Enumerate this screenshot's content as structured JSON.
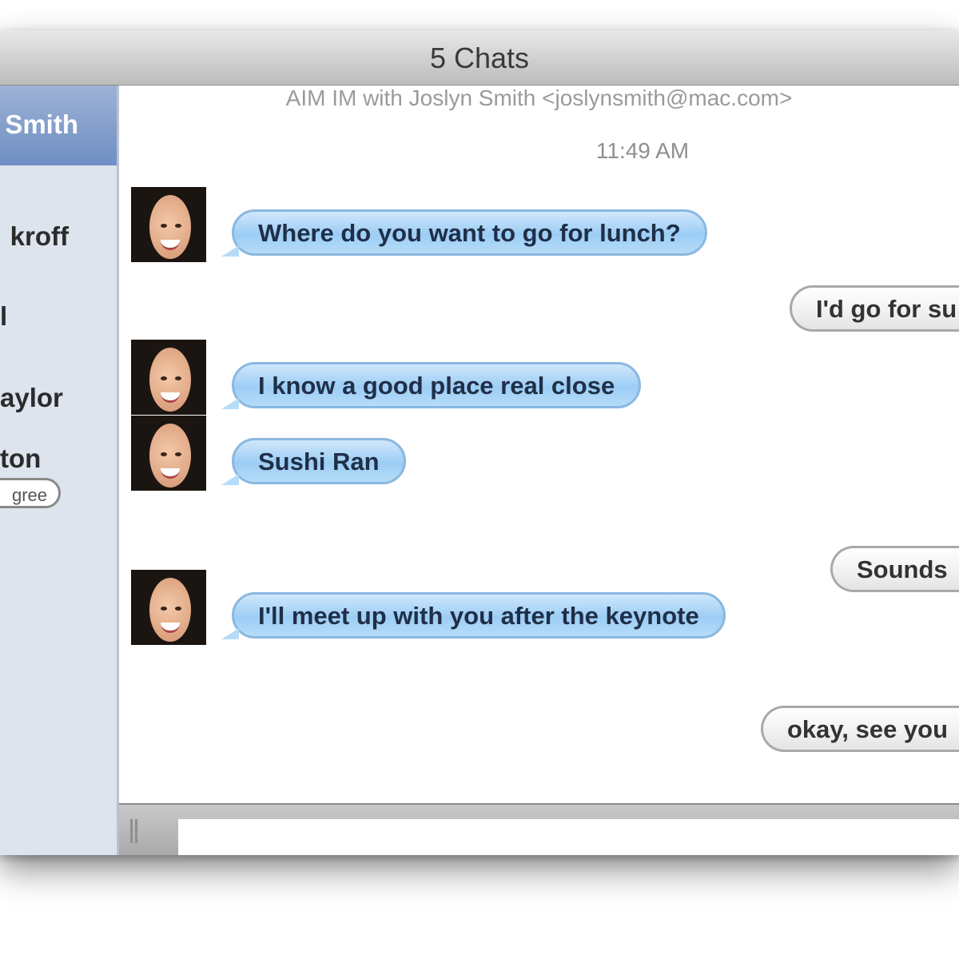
{
  "window": {
    "title": "5 Chats"
  },
  "sidebar": {
    "buddies": [
      {
        "name": "Smith",
        "selected": true
      },
      {
        "name": "kroff"
      },
      {
        "name": "l"
      },
      {
        "name": "aylor"
      },
      {
        "name": "ton",
        "status": "gree"
      }
    ]
  },
  "transcript": {
    "header": "AIM IM with Joslyn Smith <joslynsmith@mac.com>",
    "timestamp": "11:49 AM",
    "messages": [
      {
        "from": "them",
        "text": "Where do you want to go for lunch?"
      },
      {
        "from": "me",
        "text": "I'd go for su"
      },
      {
        "from": "them",
        "text": "I know a good place real close"
      },
      {
        "from": "them",
        "text": "Sushi Ran"
      },
      {
        "from": "me",
        "text": "Sounds"
      },
      {
        "from": "them",
        "text": "I'll meet up with you after the keynote"
      },
      {
        "from": "me",
        "text": "okay, see you"
      }
    ]
  },
  "composer": {
    "value": ""
  },
  "colors": {
    "incoming_bubble": "#9ccdf5",
    "sidebar_selected": "#7f9dcc",
    "sidebar_bg": "#dde4ee"
  },
  "icons": {
    "avatar": "buddy-photo",
    "grip": "drag-handle-icon"
  }
}
